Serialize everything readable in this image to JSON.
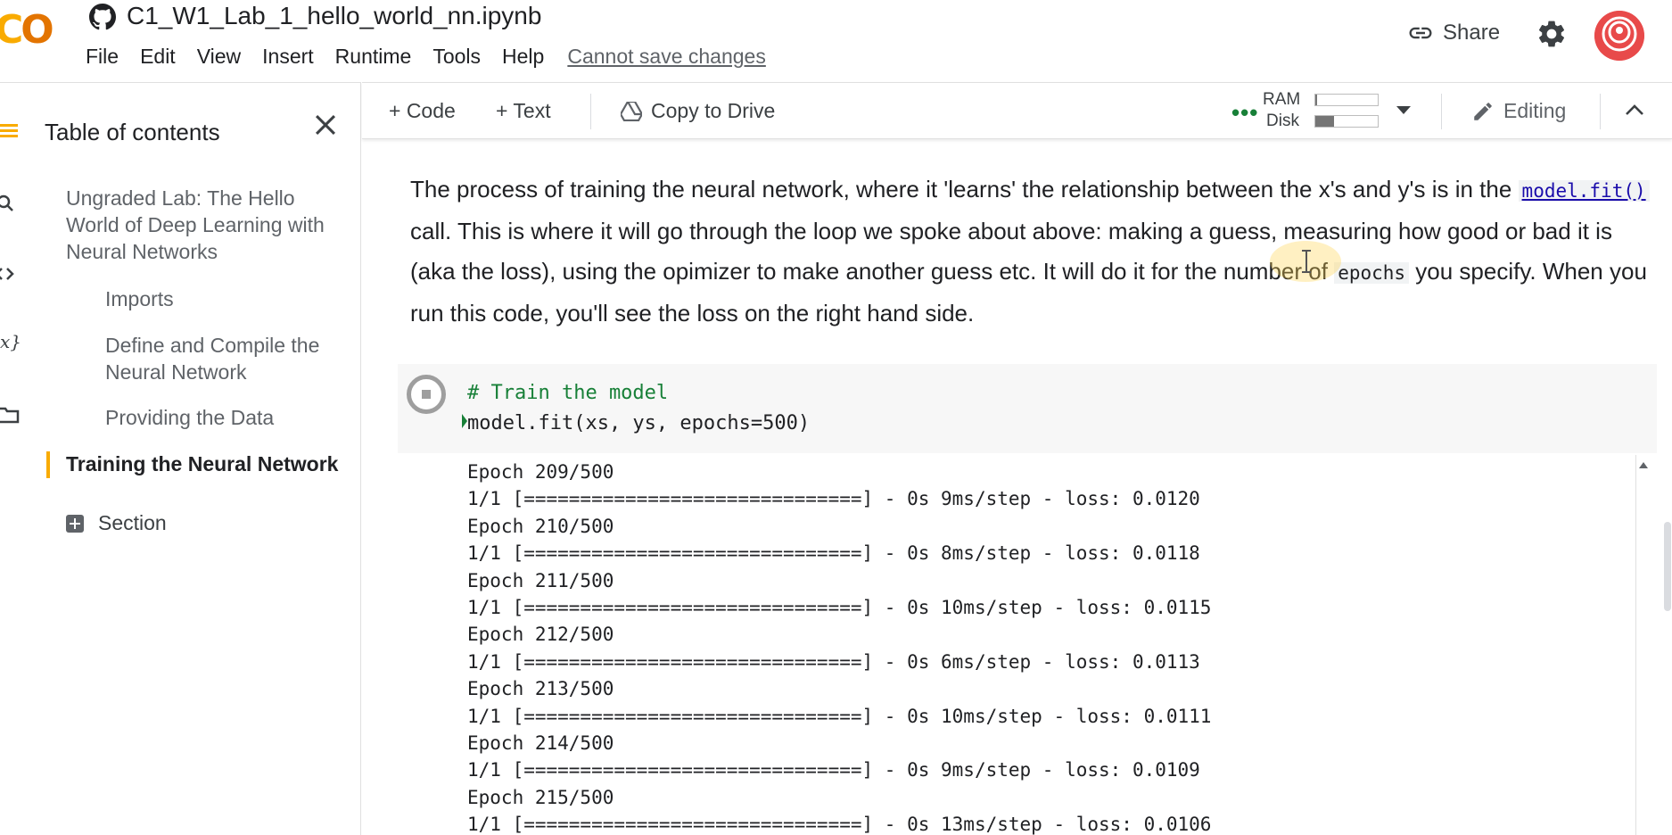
{
  "app": {
    "logo_text": "CO",
    "notebook_title": "C1_W1_Lab_1_hello_world_nn.ipynb",
    "menu": [
      "File",
      "Edit",
      "View",
      "Insert",
      "Runtime",
      "Tools",
      "Help"
    ],
    "save_status": "Cannot save changes",
    "share_label": "Share"
  },
  "sidebar": {
    "title": "Table of contents",
    "items": [
      {
        "label": "Ungraded Lab: The Hello World of Deep Learning with Neural Networks",
        "level": 1,
        "active": false
      },
      {
        "label": "Imports",
        "level": 2,
        "active": false
      },
      {
        "label": "Define and Compile the Neural Network",
        "level": 2,
        "active": false
      },
      {
        "label": "Providing the Data",
        "level": 2,
        "active": false
      },
      {
        "label": "Training the Neural Network",
        "level": 1,
        "active": true
      }
    ],
    "add_section_label": "Section"
  },
  "toolbar": {
    "add_code": "+ Code",
    "add_text": "+ Text",
    "copy_to_drive": "Copy to Drive",
    "ram_label": "RAM",
    "disk_label": "Disk",
    "ram_usage": 0.03,
    "disk_usage": 0.3,
    "mode_label": "Editing"
  },
  "text_cell": {
    "part1": "The process of training the neural network, where it 'learns' the relationship between the x's and y's is in the",
    "code1": "model.fit()",
    "part2": " call. This is where it will go through the loop we spoke about above: making a guess, measuring how good or bad it is (aka the loss), using the opimizer to make another guess etc. It will do it for the number of",
    "code2": "epochs",
    "part3": " you specify. When you run this code, you'll see the loss on the right hand side."
  },
  "code_cell": {
    "comment": "# Train the model",
    "code": "model.fit(xs, ys, epochs=500)"
  },
  "output_lines": [
    "Epoch 209/500",
    "1/1 [==============================] - 0s 9ms/step - loss: 0.0120",
    "Epoch 210/500",
    "1/1 [==============================] - 0s 8ms/step - loss: 0.0118",
    "Epoch 211/500",
    "1/1 [==============================] - 0s 10ms/step - loss: 0.0115",
    "Epoch 212/500",
    "1/1 [==============================] - 0s 6ms/step - loss: 0.0113",
    "Epoch 213/500",
    "1/1 [==============================] - 0s 10ms/step - loss: 0.0111",
    "Epoch 214/500",
    "1/1 [==============================] - 0s 9ms/step - loss: 0.0109",
    "Epoch 215/500",
    "1/1 [==============================] - 0s 13ms/step - loss: 0.0106"
  ]
}
